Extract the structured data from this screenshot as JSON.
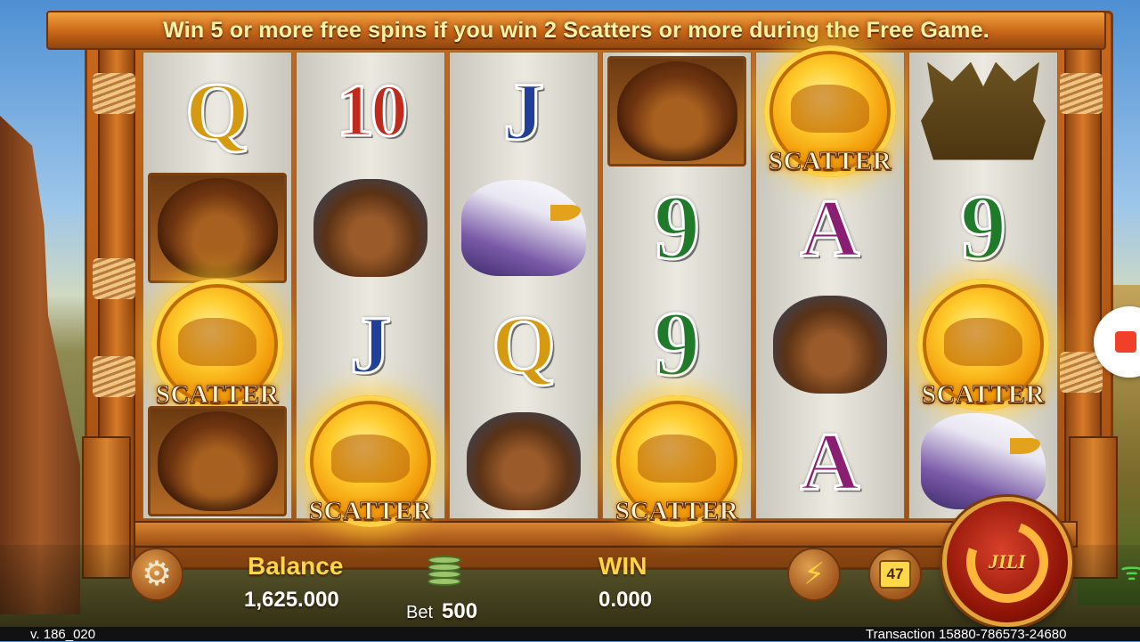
{
  "banner": {
    "text": "Win 5 or more free spins if you win 2 Scatters or more during the Free Game."
  },
  "reels": [
    [
      "Q",
      "bison",
      "scatter",
      "bison"
    ],
    [
      "10",
      "bear",
      "J",
      "scatter"
    ],
    [
      "J",
      "eagle",
      "Q",
      "bear"
    ],
    [
      "bison",
      "9",
      "9",
      "scatter"
    ],
    [
      "scatter",
      "A",
      "bear",
      "A"
    ],
    [
      "moose",
      "9",
      "scatter",
      "eagle"
    ]
  ],
  "symbols": {
    "scatter_label": "SCATTER",
    "letter_colors": {
      "Q": "#d69a10",
      "10": "#c02a1c",
      "J": "#1f3f9a",
      "9": "#1f7a2a",
      "A": "#8a1f72"
    }
  },
  "hud": {
    "balance_label": "Balance",
    "balance_value": "1,625.000",
    "bet_label": "Bet",
    "bet_value": "500",
    "win_label": "WIN",
    "win_value": "0.000",
    "auto_badge": "47",
    "spin_logo": "JILI",
    "settings_icon": "gear-icon",
    "turbo_icon": "lightning-icon"
  },
  "status_bar": {
    "version": "v. 186_020",
    "transaction": "Transaction 15880-786573-24680"
  },
  "colors": {
    "banner_text": "#fff3a8",
    "label_gold": "#ffd548",
    "frame_wood": "#c8681b"
  }
}
